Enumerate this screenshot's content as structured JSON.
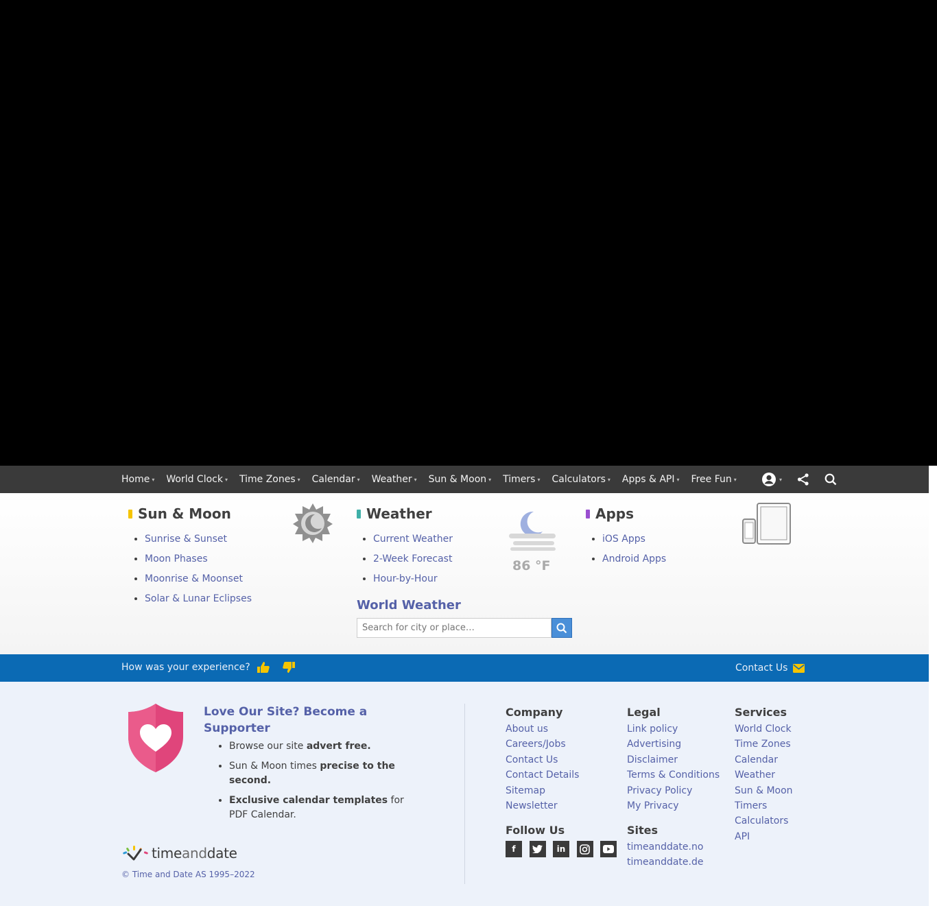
{
  "nav": {
    "items": [
      {
        "label": "Home"
      },
      {
        "label": "World Clock"
      },
      {
        "label": "Time Zones"
      },
      {
        "label": "Calendar"
      },
      {
        "label": "Weather"
      },
      {
        "label": "Sun & Moon"
      },
      {
        "label": "Timers"
      },
      {
        "label": "Calculators"
      },
      {
        "label": "Apps & API"
      },
      {
        "label": "Free Fun"
      }
    ],
    "icons": [
      "user-icon",
      "share-icon",
      "search-icon"
    ]
  },
  "mega": {
    "sun_moon": {
      "title": "Sun & Moon",
      "accent": "#f5c400",
      "links": [
        "Sunrise & Sunset",
        "Moon Phases",
        "Moonrise & Moonset",
        "Solar & Lunar Eclipses"
      ]
    },
    "weather": {
      "title": "Weather",
      "accent": "#3fb0a8",
      "links": [
        "Current Weather",
        "2-Week Forecast",
        "Hour-by-Hour"
      ],
      "temperature": "86 °F"
    },
    "apps": {
      "title": "Apps",
      "accent": "#9a4fd0",
      "links": [
        "iOS Apps",
        "Android Apps"
      ]
    },
    "world_weather": {
      "title": "World Weather",
      "placeholder": "Search for city or place…"
    }
  },
  "feedback": {
    "question": "How was your experience?",
    "contact_label": "Contact Us"
  },
  "footer": {
    "love": {
      "title": "Love Our Site? Become a Supporter",
      "items": [
        {
          "pre": "Browse our site ",
          "bold": "advert free.",
          "post": ""
        },
        {
          "pre": "Sun & Moon times ",
          "bold": "precise to the second.",
          "post": ""
        },
        {
          "pre": "",
          "bold": "Exclusive calendar templates",
          "post": " for PDF Calendar."
        }
      ]
    },
    "logo": {
      "time": "time",
      "and": "and",
      "date": "date"
    },
    "copyright": "© Time and Date AS 1995–2022",
    "company": {
      "title": "Company",
      "links": [
        "About us",
        "Careers/Jobs",
        "Contact Us",
        "Contact Details",
        "Sitemap",
        "Newsletter"
      ]
    },
    "legal": {
      "title": "Legal",
      "links": [
        "Link policy",
        "Advertising",
        "Disclaimer",
        "Terms & Conditions",
        "Privacy Policy",
        "My Privacy"
      ]
    },
    "services": {
      "title": "Services",
      "links": [
        "World Clock",
        "Time Zones",
        "Calendar",
        "Weather",
        "Sun & Moon",
        "Timers",
        "Calculators",
        "API"
      ]
    },
    "follow": {
      "title": "Follow Us",
      "icons": [
        "facebook-icon",
        "twitter-icon",
        "linkedin-icon",
        "instagram-icon",
        "youtube-icon"
      ]
    },
    "sites": {
      "title": "Sites",
      "links": [
        "timeanddate.no",
        "timeanddate.de"
      ]
    }
  },
  "colors": {
    "nav_bg": "#3a3a3a",
    "feedback_bg": "#0b6ab4",
    "footer_bg": "#edf2fa",
    "link": "#5561a8"
  }
}
